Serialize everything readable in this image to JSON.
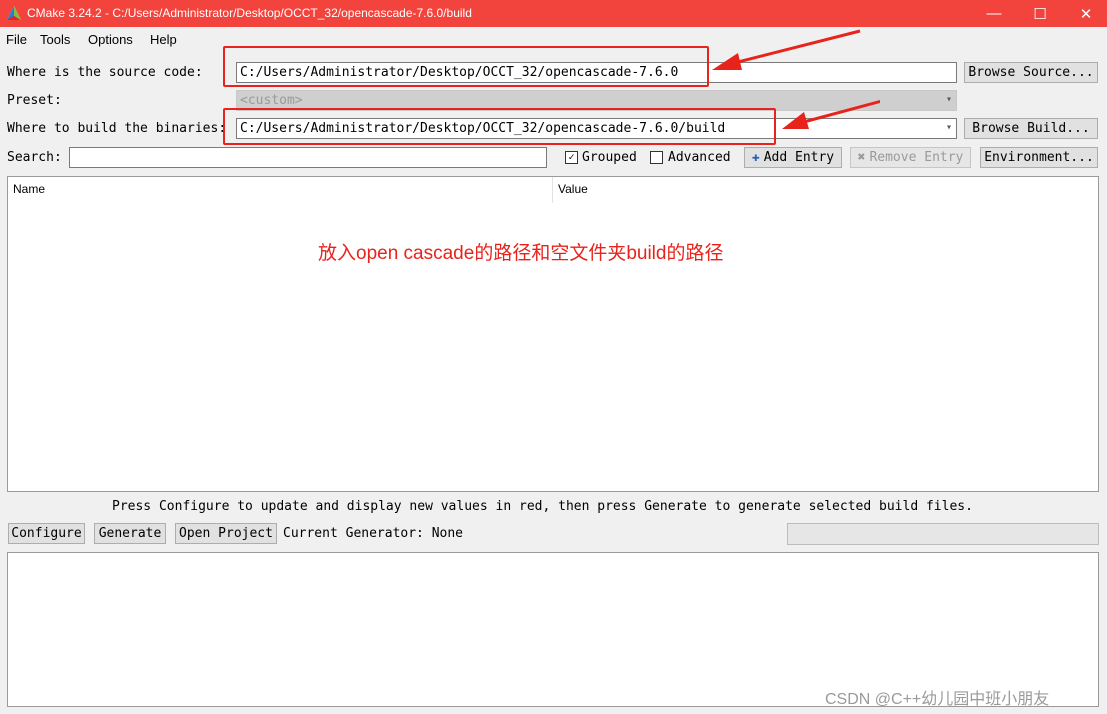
{
  "window": {
    "title": "CMake 3.24.2 - C:/Users/Administrator/Desktop/OCCT_32/opencascade-7.6.0/build",
    "minimize_glyph": "—",
    "maximize_glyph": "☐",
    "close_glyph": "✕"
  },
  "menu": [
    "File",
    "Tools",
    "Options",
    "Help"
  ],
  "source": {
    "label": "Where is the source code:",
    "value": "C:/Users/Administrator/Desktop/OCCT_32/opencascade-7.6.0",
    "browse_label": "Browse Source..."
  },
  "preset": {
    "label": "Preset:",
    "value": "<custom>"
  },
  "build": {
    "label": "Where to build the binaries:",
    "value": "C:/Users/Administrator/Desktop/OCCT_32/opencascade-7.6.0/build",
    "browse_label": "Browse Build..."
  },
  "search": {
    "label": "Search:",
    "value": "",
    "grouped_label": "Grouped",
    "grouped_checked": true,
    "advanced_label": "Advanced",
    "advanced_checked": false,
    "add_entry_label": "Add Entry",
    "remove_entry_label": "Remove Entry",
    "environment_label": "Environment..."
  },
  "table": {
    "columns": [
      "Name",
      "Value"
    ]
  },
  "annotation": "放入open cascade的路径和空文件夹build的路径",
  "status_message": "Press Configure to update and display new values in red, then press Generate to generate selected build files.",
  "actions": {
    "configure": "Configure",
    "generate": "Generate",
    "open_project": "Open Project",
    "generator_text": "Current Generator: None"
  },
  "watermark": "CSDN @C++幼儿园中班小朋友",
  "colors": {
    "titlebar": "#f2433d",
    "annotation_red": "#e8231b"
  }
}
